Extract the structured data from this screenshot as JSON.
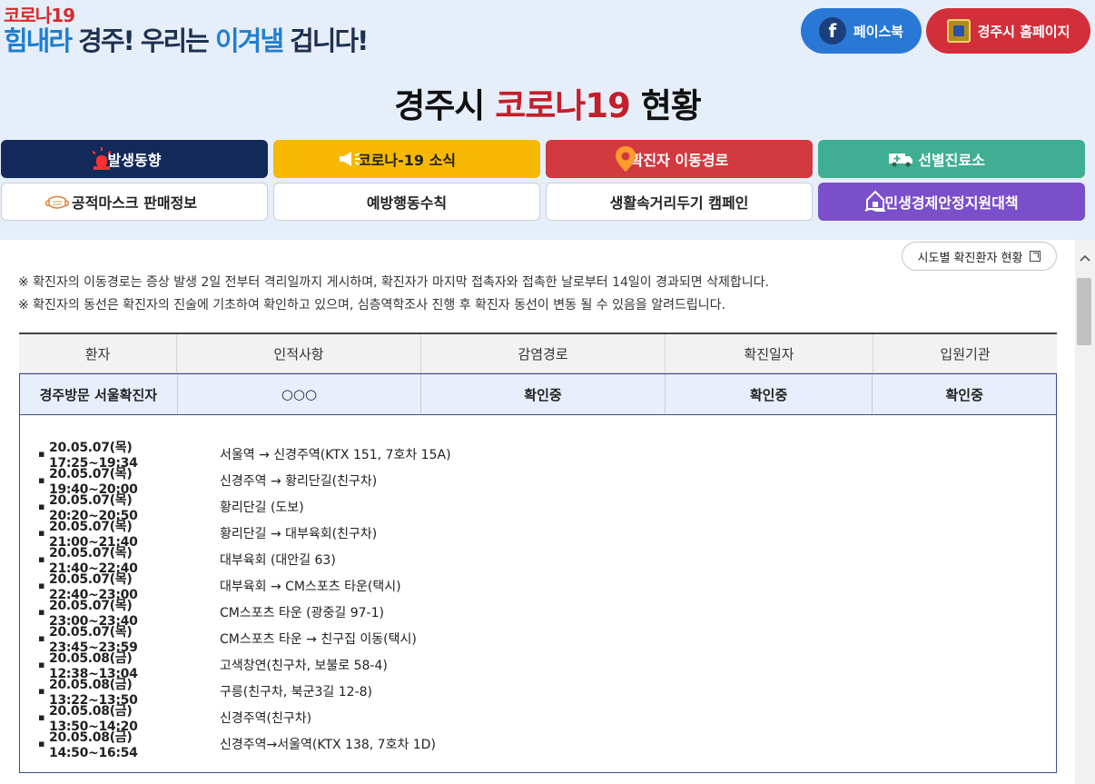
{
  "header": {
    "logo_line1": "코로나19",
    "logo_slogan_a": "힘내라",
    "logo_slogan_b": " 경주! 우리는 ",
    "logo_slogan_c": "이겨낼",
    "logo_slogan_d": " 겁니다!",
    "facebook_label": "페이스북",
    "homepage_label": "경주시 홈페이지",
    "title_a": "경주시 ",
    "title_b": "코로나19",
    "title_c": " 현황"
  },
  "nav": {
    "row1": [
      {
        "label": "발생동향",
        "icon": "siren-icon"
      },
      {
        "label": "코로나-19 소식",
        "icon": "megaphone-icon"
      },
      {
        "label": "확진자 이동경로",
        "icon": "map-pin-icon"
      },
      {
        "label": "선별진료소",
        "icon": "ambulance-icon"
      }
    ],
    "row2": [
      {
        "label": "공적마스크 판매정보",
        "icon": "mask-icon"
      },
      {
        "label": "예방행동수칙"
      },
      {
        "label": "생활속거리두기 캠페인"
      },
      {
        "label": "민생경제안정지원대책",
        "icon": "house-hand-icon"
      }
    ]
  },
  "region_button": "시도별 확진환자 현황",
  "notices": [
    "※ 확진자의 이동경로는 증상 발생 2일 전부터 격리일까지 게시하며, 확진자가 마지막 접촉자와 접촉한 날로부터 14일이 경과되면 삭제합니다.",
    "※ 확진자의 동선은 확진자의 진술에 기초하여 확인하고 있으며, 심층역학조사 진행 후 확진자 동선이 변동 될 수 있음을 알려드립니다."
  ],
  "table": {
    "headers": [
      "환자",
      "인적사항",
      "감염경로",
      "확진일자",
      "입원기관"
    ],
    "row": [
      "경주방문 서울확진자",
      "○○○",
      "확인중",
      "확인중",
      "확인중"
    ]
  },
  "routes": [
    {
      "time": "20.05.07(목) 17:25~19:34",
      "place": "서울역 → 신경주역(KTX 151, 7호차 15A)"
    },
    {
      "time": "20.05.07(목) 19:40~20:00",
      "place": "신경주역 → 황리단길(친구차)"
    },
    {
      "time": "20.05.07(목) 20:20~20:50",
      "place": "황리단길 (도보)"
    },
    {
      "time": "20.05.07(목) 21:00~21:40",
      "place": "황리단길 → 대부육회(친구차)"
    },
    {
      "time": "20.05.07(목) 21:40~22:40",
      "place": "대부육회 (대안길 63)"
    },
    {
      "time": "20.05.07(목) 22:40~23:00",
      "place": "대부육회 → CM스포츠 타운(택시)"
    },
    {
      "time": "20.05.07(목) 23:00~23:40",
      "place": "CM스포츠 타운 (광중길 97-1)"
    },
    {
      "time": "20.05.07(목) 23:45~23:59",
      "place": "CM스포츠 타운 → 친구집 이동(택시)"
    },
    {
      "time": "20.05.08(금) 12:38~13:04",
      "place": "고색창연(친구차, 보불로 58-4)"
    },
    {
      "time": "20.05.08(금) 13:22~13:50",
      "place": "구릉(친구차, 북군3길 12-8)"
    },
    {
      "time": "20.05.08(금) 13:50~14:20",
      "place": "신경주역(친구차)"
    },
    {
      "time": "20.05.08(금) 14:50~16:54",
      "place": "신경주역→서울역(KTX 138, 7호차 1D)"
    }
  ],
  "colors": {
    "header_bg": "#e6eef9",
    "brand_blue": "#1f7fd1",
    "brand_red": "#c41f2a",
    "nav_navy": "#13295a",
    "nav_yellow": "#f6b800",
    "nav_red": "#d13a3f",
    "nav_teal": "#3fae93",
    "nav_purple": "#7b4fcb"
  }
}
